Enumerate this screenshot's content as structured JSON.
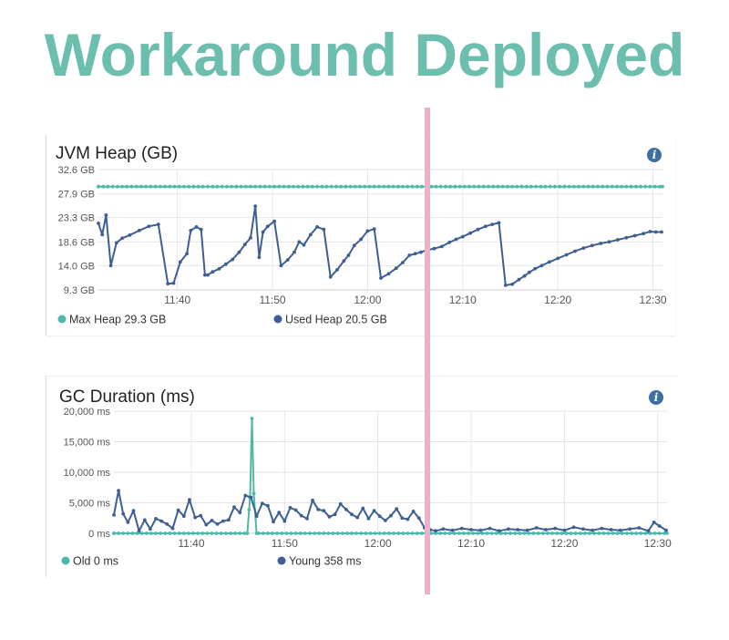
{
  "headline": "Workaround Deployed",
  "colors": {
    "headline": "#6cbfae",
    "max_heap": "#4fb9a9",
    "used_heap": "#3f5f93",
    "old": "#4fb9a9",
    "young": "#3f5f93",
    "marker": "#e9b2c8",
    "info": "#3f6fa0"
  },
  "icons": [
    "info-icon",
    "legend-dot-icon"
  ],
  "chart_data": [
    {
      "type": "line",
      "title": "JVM Heap (GB)",
      "y_ticks": [
        "32.6 GB",
        "27.9 GB",
        "23.3 GB",
        "18.6 GB",
        "14.0 GB",
        "9.3 GB"
      ],
      "y_tick_values": [
        32.6,
        27.9,
        23.3,
        18.6,
        14.0,
        9.3
      ],
      "ylim": [
        9.3,
        32.6
      ],
      "x_ticks": [
        "11:40",
        "11:50",
        "12:00",
        "12:10",
        "12:20",
        "12:30"
      ],
      "x_tick_minutes": [
        40,
        50,
        60,
        70,
        80,
        90
      ],
      "xlim": [
        31.7,
        91
      ],
      "grid": true,
      "legend_position": "bottom",
      "series": [
        {
          "name": "Max Heap 29.3 GB",
          "color_key": "max_heap",
          "x": [
            31.7,
            91
          ],
          "y": [
            29.3,
            29.3
          ],
          "dense_markers": true
        },
        {
          "name": "Used Heap 20.5 GB",
          "color_key": "used_heap",
          "x": [
            31.7,
            32.1,
            32.5,
            33.0,
            33.6,
            34.2,
            35.0,
            36.0,
            37.0,
            38.0,
            39.0,
            39.6,
            40.3,
            41.0,
            41.4,
            42.0,
            42.5,
            42.9,
            43.2,
            43.7,
            44.4,
            45.1,
            45.8,
            46.5,
            47.1,
            47.7,
            48.2,
            48.6,
            49.0,
            49.5,
            50.2,
            50.9,
            51.6,
            52.3,
            52.8,
            53.3,
            54.0,
            54.7,
            55.4,
            56.1,
            56.8,
            57.5,
            58.0,
            58.6,
            59.3,
            60.0,
            60.7,
            61.4,
            62.2,
            63.0,
            63.7,
            64.4,
            65.0,
            65.6,
            66.2,
            67.0,
            67.8,
            68.6,
            69.3,
            70.0,
            70.8,
            71.6,
            72.4,
            73.1,
            73.8,
            74.5,
            75.2,
            75.9,
            76.5,
            77.0,
            77.6,
            78.3,
            79.1,
            80.0,
            80.9,
            81.8,
            82.7,
            83.6,
            84.5,
            85.4,
            86.3,
            87.2,
            88.1,
            89.0,
            89.7,
            90.3,
            90.9
          ],
          "y": [
            22.2,
            20.0,
            23.8,
            14.0,
            18.4,
            19.3,
            19.9,
            20.8,
            21.6,
            22.0,
            10.5,
            10.6,
            14.7,
            16.3,
            20.8,
            21.5,
            21.0,
            12.2,
            12.2,
            12.8,
            13.4,
            14.3,
            15.2,
            16.6,
            18.1,
            19.4,
            25.5,
            15.6,
            20.5,
            21.6,
            22.6,
            14.0,
            15.1,
            16.6,
            18.6,
            18.0,
            20.0,
            21.5,
            21.0,
            11.8,
            13.2,
            14.9,
            16.0,
            17.9,
            19.1,
            20.7,
            21.1,
            11.6,
            12.4,
            13.5,
            14.6,
            16.0,
            16.3,
            16.6,
            17.0,
            17.3,
            17.7,
            18.5,
            19.1,
            19.6,
            20.3,
            21.0,
            21.6,
            22.0,
            22.3,
            10.2,
            10.4,
            11.3,
            12.0,
            12.7,
            13.4,
            14.0,
            14.7,
            15.4,
            16.1,
            16.8,
            17.4,
            17.9,
            18.3,
            18.6,
            19.0,
            19.4,
            19.8,
            20.2,
            20.6,
            20.5,
            20.5
          ]
        }
      ]
    },
    {
      "type": "line",
      "title": "GC Duration (ms)",
      "y_ticks": [
        "20,000 ms",
        "15,000 ms",
        "10,000 ms",
        "5,000 ms",
        "0 ms"
      ],
      "y_tick_values": [
        20000,
        15000,
        10000,
        5000,
        0
      ],
      "ylim": [
        0,
        20000
      ],
      "x_ticks": [
        "11:40",
        "11:50",
        "12:00",
        "12:10",
        "12:20",
        "12:30"
      ],
      "x_tick_minutes": [
        40,
        50,
        60,
        70,
        80,
        90
      ],
      "xlim": [
        31.7,
        91
      ],
      "grid": true,
      "legend_position": "bottom",
      "series": [
        {
          "name": "Old 0 ms",
          "color_key": "old",
          "x": [
            31.7,
            46.0,
            46.3,
            46.5,
            46.7,
            47.0,
            91
          ],
          "y": [
            0,
            0,
            5800,
            18800,
            6500,
            0,
            0
          ],
          "dense_markers": true
        },
        {
          "name": "Young 358 ms",
          "color_key": "young",
          "x": [
            31.7,
            32.2,
            32.7,
            33.2,
            33.8,
            34.4,
            35.0,
            35.6,
            36.2,
            36.8,
            37.4,
            38.0,
            38.6,
            39.2,
            39.8,
            40.4,
            41.0,
            41.6,
            42.2,
            42.8,
            43.4,
            44.0,
            44.6,
            45.2,
            45.8,
            46.4,
            47.0,
            47.6,
            48.2,
            48.8,
            49.4,
            50.0,
            50.6,
            51.2,
            51.8,
            52.4,
            53.0,
            53.6,
            54.2,
            54.8,
            55.4,
            56.0,
            56.6,
            57.2,
            57.8,
            58.4,
            59.0,
            59.6,
            60.2,
            60.8,
            61.4,
            62.0,
            62.6,
            63.2,
            63.8,
            64.4,
            65.0,
            65.6,
            66.2,
            67.0,
            68.0,
            69.0,
            70.0,
            71.0,
            72.0,
            73.0,
            74.0,
            75.0,
            76.0,
            77.0,
            78.0,
            79.0,
            80.0,
            81.0,
            82.0,
            83.0,
            84.0,
            85.0,
            86.0,
            87.0,
            88.0,
            89.0,
            89.6,
            90.2,
            90.9
          ],
          "y": [
            3000,
            7000,
            3200,
            1800,
            3700,
            400,
            2200,
            700,
            2400,
            2000,
            1500,
            800,
            3800,
            2800,
            5500,
            2600,
            2900,
            1400,
            2100,
            1500,
            2000,
            2200,
            4300,
            3400,
            6200,
            5900,
            2800,
            4900,
            4500,
            1900,
            3400,
            2000,
            4200,
            3800,
            2900,
            2400,
            5400,
            3900,
            3700,
            2700,
            3100,
            4800,
            3900,
            3100,
            2600,
            4100,
            2400,
            3700,
            2800,
            2100,
            2900,
            4000,
            2500,
            2300,
            3600,
            2500,
            900,
            600,
            400,
            700,
            500,
            800,
            600,
            500,
            800,
            400,
            700,
            600,
            500,
            900,
            600,
            800,
            500,
            1000,
            700,
            500,
            800,
            600,
            500,
            700,
            900,
            400,
            1800,
            1200,
            500
          ]
        }
      ]
    }
  ]
}
